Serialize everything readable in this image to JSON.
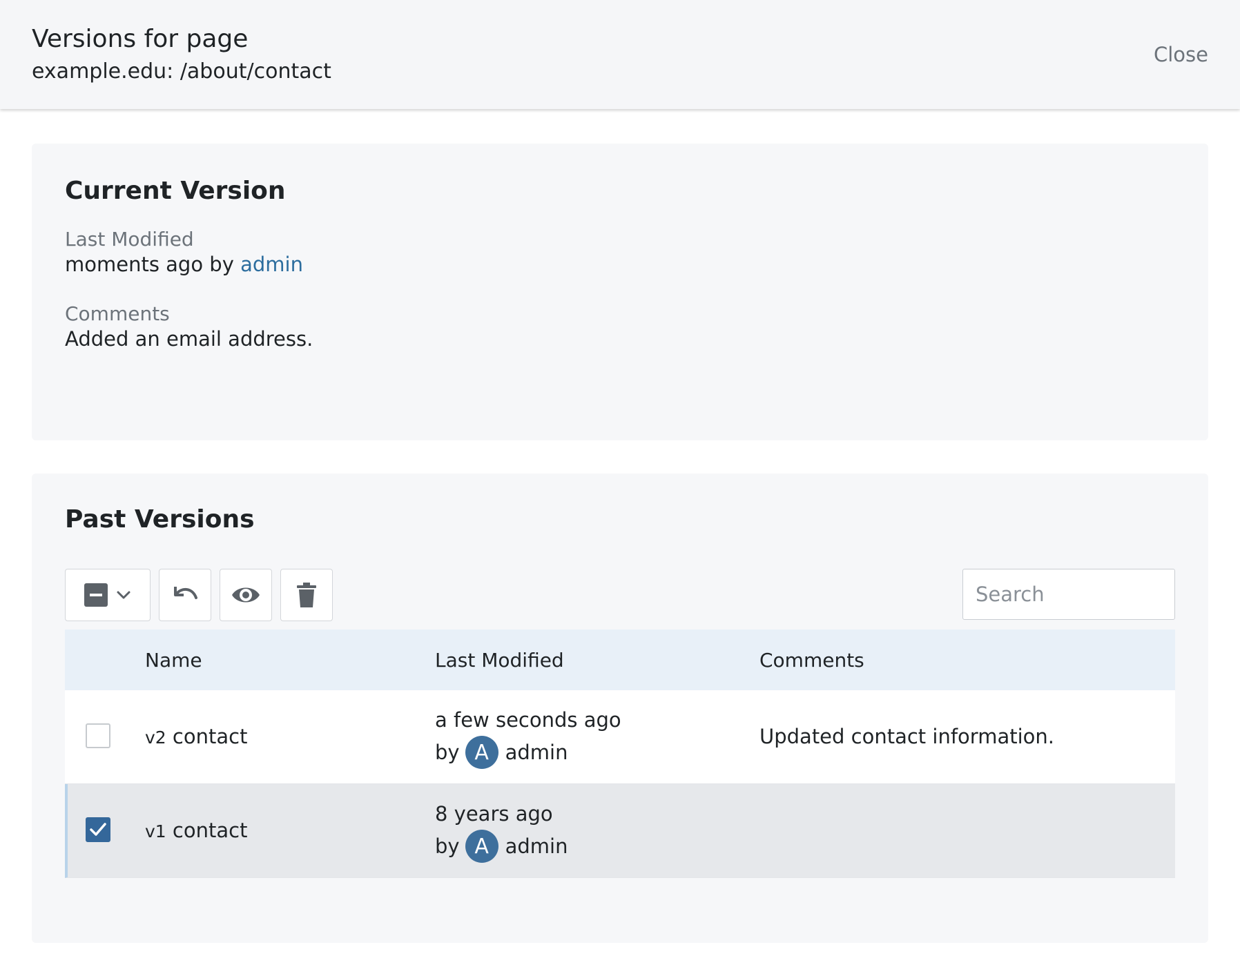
{
  "header": {
    "title": "Versions for page",
    "subtitle": "example.edu: /about/contact",
    "close_label": "Close"
  },
  "current_version": {
    "heading": "Current Version",
    "last_modified_label": "Last Modified",
    "last_modified_text": "moments ago by ",
    "last_modified_user": "admin",
    "comments_label": "Comments",
    "comments_value": "Added an email address."
  },
  "past_versions": {
    "heading": "Past Versions",
    "toolbar": {
      "select_icon": "minus-square-icon",
      "dropdown_icon": "chevron-down-icon",
      "restore_icon": "undo-icon",
      "preview_icon": "eye-icon",
      "delete_icon": "trash-icon"
    },
    "search_placeholder": "Search",
    "columns": [
      "Name",
      "Last Modified",
      "Comments"
    ],
    "rows": [
      {
        "checked": false,
        "version": "v2",
        "name": "contact",
        "time": "a few seconds ago",
        "by_label": "by",
        "avatar_letter": "A",
        "user": "admin",
        "comment": "Updated contact information."
      },
      {
        "checked": true,
        "version": "v1",
        "name": "contact",
        "time": "8 years ago",
        "by_label": "by",
        "avatar_letter": "A",
        "user": "admin",
        "comment": ""
      }
    ]
  },
  "colors": {
    "accent": "#34679a",
    "link": "#2c6d9e",
    "header_row": "#e8f0f8",
    "selected_row": "#e6e8eb"
  }
}
